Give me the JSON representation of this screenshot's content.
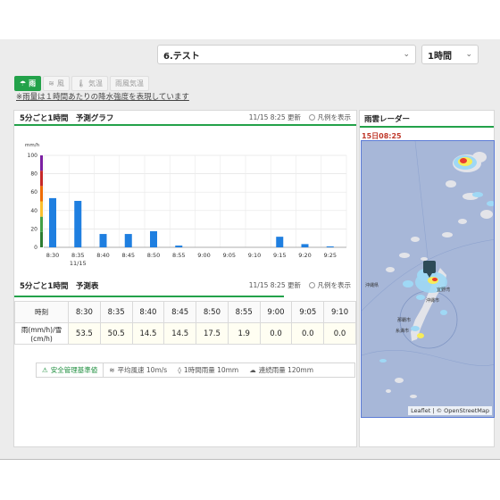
{
  "header": {
    "point_select": "6.テスト",
    "interval_select": "1時間"
  },
  "weather_tabs": [
    {
      "label": "雨",
      "icon": "cloud-rain-icon",
      "active": true
    },
    {
      "label": "風",
      "icon": "wind-icon",
      "active": false
    },
    {
      "label": "気温",
      "icon": "thermometer-icon",
      "active": false
    },
    {
      "label": "雨風気温",
      "icon": "",
      "active": false
    }
  ],
  "note": "※雨量は１時間あたりの降水強度を表現しています",
  "graph_panel": {
    "title": "5分ごと1時間　予測グラフ",
    "updated": "11/15 8:25 更新",
    "legend_toggle": "凡例を表示"
  },
  "chart_data": {
    "type": "bar",
    "ylabel": "mm/h",
    "ylim": [
      0,
      100
    ],
    "yticks": [
      0,
      20,
      40,
      60,
      80,
      100
    ],
    "categories": [
      "8:30",
      "8:35",
      "8:40",
      "8:45",
      "8:50",
      "8:55",
      "9:00",
      "9:05",
      "9:10",
      "9:15",
      "9:20",
      "9:25"
    ],
    "sublabel": {
      "index": 1,
      "text": "11/15"
    },
    "values": [
      53.5,
      50.5,
      14.5,
      14.5,
      17.5,
      1.9,
      0.0,
      0.0,
      0.0,
      11.5,
      3.5,
      1.0
    ],
    "bar_color": "#1f7fe0",
    "scale_colors": [
      "#2e7d32",
      "#43a047",
      "#fbc02d",
      "#ef6c00",
      "#c62828",
      "#7b1fa2"
    ]
  },
  "table_panel": {
    "title": "5分ごと1時間　予測表",
    "updated": "11/15 8:25 更新",
    "legend_toggle": "凡例を表示",
    "row_labels": {
      "time": "時刻",
      "rain": "雨(mm/h)/雪(cm/h)"
    },
    "times": [
      "8:30",
      "8:35",
      "8:40",
      "8:45",
      "8:50",
      "8:55",
      "9:00",
      "9:05",
      "9:10"
    ],
    "values": [
      "53.5",
      "50.5",
      "14.5",
      "14.5",
      "17.5",
      "1.9",
      "0.0",
      "0.0",
      "0.0"
    ]
  },
  "criteria": [
    {
      "label": "安全管理基準値",
      "icon": "alert-icon"
    },
    {
      "label": "平均風速 10m/s",
      "icon": "wind-icon"
    },
    {
      "label": "1時間雨量 10mm",
      "icon": "drop-icon"
    },
    {
      "label": "連続雨量 120mm",
      "icon": "cloud-icon"
    }
  ],
  "radar": {
    "title": "雨雲レーダー",
    "timestamp": "15日08:25",
    "attribution": "Leaflet | © OpenStreetMap",
    "places": [
      "沖縄県",
      "宜野湾",
      "沖縄市",
      "那覇市",
      "糸満市"
    ],
    "colors": {
      "sea": "#a7b7d8",
      "land": "#e3e4e9",
      "marker": "#2d4b58",
      "rain_low": "#9fd8f5",
      "rain_mid": "#f7ec5a",
      "rain_high": "#e93b2f"
    }
  }
}
